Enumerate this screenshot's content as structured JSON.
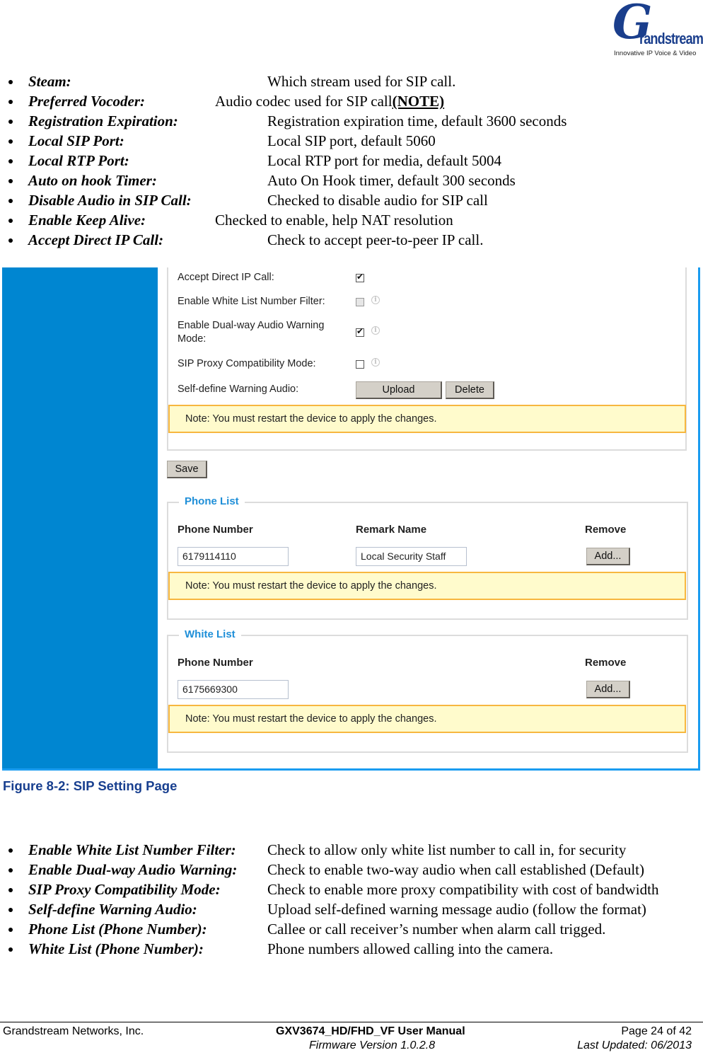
{
  "logo": {
    "mark": "G",
    "wordmark": "randstream",
    "tagline": "Innovative IP Voice & Video"
  },
  "list1": [
    {
      "term": "Steam:",
      "desc": "Which stream used for SIP call."
    },
    {
      "term": "Preferred Vocoder:",
      "desc": "Audio codec used for SIP call",
      "link": "(NOTE)"
    },
    {
      "term": "Registration Expiration:",
      "desc": "Registration expiration time, default 3600 seconds"
    },
    {
      "term": "Local SIP Port:",
      "desc": "Local SIP port, default 5060"
    },
    {
      "term": "Local RTP Port:",
      "desc": "Local RTP port for media, default 5004"
    },
    {
      "term": "Auto on hook Timer:",
      "desc": "Auto On Hook timer, default 300 seconds"
    },
    {
      "term": "Disable Audio in SIP Call:",
      "desc": "Checked to disable audio for SIP call"
    },
    {
      "term": "Enable Keep Alive:",
      "desc": "Checked to enable, help NAT resolution"
    },
    {
      "term": "Accept Direct IP Call:",
      "desc": "Check to accept peer-to-peer IP call."
    }
  ],
  "screenshot": {
    "colors": {
      "sidebar": "#0086d1",
      "accent": "#1f8fd8",
      "note_bg": "#fffbcc",
      "note_border": "#f7b73f",
      "frame": "#1a9cf0"
    },
    "settings": [
      {
        "label": "Accept Direct IP Call:",
        "checked": true,
        "disabled": false,
        "info": false
      },
      {
        "label": "Enable White List Number Filter:",
        "checked": false,
        "disabled": true,
        "info": true
      },
      {
        "label_line1": "Enable Dual-way Audio Warning",
        "label_line2": "Mode:",
        "checked": true,
        "disabled": false,
        "info": true
      },
      {
        "label": "SIP Proxy Compatibility Mode:",
        "checked": false,
        "disabled": false,
        "info": true
      },
      {
        "label": "Self-define Warning Audio:"
      }
    ],
    "upload_label": "Upload",
    "delete_label": "Delete",
    "note": "Note: You must restart the device to apply the changes.",
    "save_label": "Save",
    "phone_list": {
      "legend": "Phone List",
      "col_phone": "Phone Number",
      "col_remark": "Remark Name",
      "col_remove": "Remove",
      "phone_value": "6179114110",
      "remark_value": "Local Security Staff",
      "add_label": "Add...",
      "note": "Note: You must restart the device to apply the changes."
    },
    "white_list": {
      "legend": "White List",
      "col_phone": "Phone Number",
      "col_remove": "Remove",
      "phone_value": "6175669300",
      "add_label": "Add...",
      "note": "Note: You must restart the device to apply the changes."
    }
  },
  "caption": "Figure 8-2:  SIP Setting Page",
  "list2": [
    {
      "term": "Enable White List Number Filter:",
      "desc": "Check to allow only white list number to call in, for security"
    },
    {
      "term": "Enable Dual-way Audio Warning:",
      "desc": "Check to enable two-way audio when call established (Default)"
    },
    {
      "term": "SIP Proxy Compatibility Mode:",
      "desc": "Check to enable more proxy compatibility with cost of bandwidth"
    },
    {
      "term": "Self-define Warning Audio:",
      "desc": "Upload self-defined warning message audio (follow the format)"
    },
    {
      "term": "Phone List (Phone Number):",
      "desc": "Callee or call receiver’s number when alarm call trigged."
    },
    {
      "term": "White List (Phone Number):",
      "desc": "Phone numbers allowed calling into the camera."
    }
  ],
  "footer": {
    "company": "Grandstream Networks, Inc.",
    "manual": "GXV3674_HD/FHD_VF User Manual",
    "firmware": "Firmware Version 1.0.2.8",
    "page": "Page 24 of 42",
    "updated": "Last Updated: 06/2013"
  }
}
